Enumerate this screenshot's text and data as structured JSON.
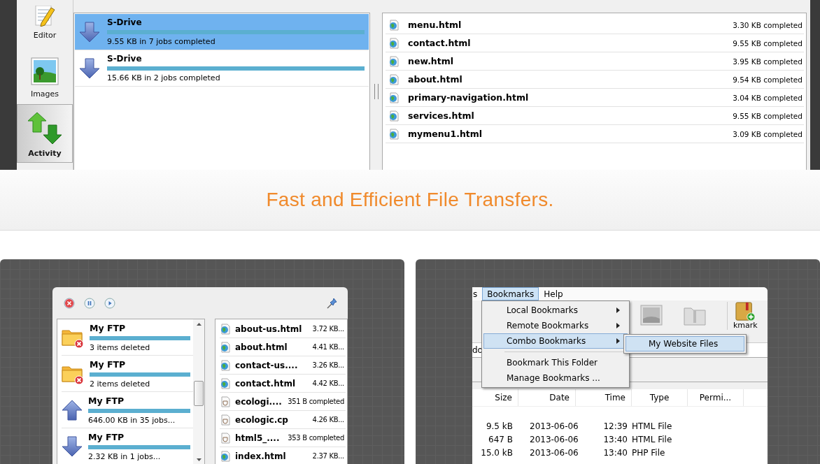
{
  "top_app": {
    "sidebar": {
      "items": [
        {
          "label": "Editor",
          "kind": "editor",
          "selected": false
        },
        {
          "label": "Images",
          "kind": "images",
          "selected": false
        },
        {
          "label": "Activity",
          "kind": "activity",
          "selected": true
        }
      ]
    },
    "transfers": [
      {
        "name": "S-Drive",
        "kind": "download",
        "level": 1,
        "status": "9.55 KB in 7 jobs completed",
        "selected": true
      },
      {
        "name": "S-Drive",
        "kind": "download",
        "level": 1,
        "status": "15.66 KB in 2 jobs completed",
        "selected": false
      }
    ],
    "files": [
      {
        "name": "menu.html",
        "status": "3.30 KB completed"
      },
      {
        "name": "contact.html",
        "status": "9.55 KB completed"
      },
      {
        "name": "new.html",
        "status": "3.95 KB completed"
      },
      {
        "name": "about.html",
        "status": "9.54 KB completed"
      },
      {
        "name": "primary-navigation.html",
        "status": "3.04 KB completed"
      },
      {
        "name": "services.html",
        "status": "9.55 KB completed"
      },
      {
        "name": "mymenu1.html",
        "status": "3.09 KB completed"
      }
    ]
  },
  "banner": {
    "title": "Fast and Efficient File Transfers."
  },
  "activity_window": {
    "transfers": [
      {
        "name": "My FTP",
        "kind": "deleted",
        "level": 1,
        "status": "3 items deleted"
      },
      {
        "name": "My FTP",
        "kind": "deleted",
        "level": 1,
        "status": "2 items deleted"
      },
      {
        "name": "My FTP",
        "kind": "upload",
        "level": 1,
        "status": "646.00 KB in 35 jobs..."
      },
      {
        "name": "My FTP",
        "kind": "download",
        "level": 1,
        "status": "2.32 KB in 1 jobs..."
      }
    ],
    "files": [
      {
        "name": "about-us.html",
        "kind": "web",
        "status": "3.72 KB..."
      },
      {
        "name": "about.html",
        "kind": "web",
        "status": "4.41 KB..."
      },
      {
        "name": "contact-us....",
        "kind": "web",
        "status": "3.26 KB..."
      },
      {
        "name": "contact.html",
        "kind": "web",
        "status": "4.42 KB..."
      },
      {
        "name": "ecologi....",
        "kind": "script",
        "status": "351 B completed"
      },
      {
        "name": "ecologic.cp",
        "kind": "script",
        "status": "4.26 KB..."
      },
      {
        "name": "html5_....",
        "kind": "script",
        "status": "353 B completed"
      },
      {
        "name": "index.html",
        "kind": "web",
        "status": "2.37 KB..."
      }
    ]
  },
  "browser_window": {
    "menubar": [
      {
        "label": "s",
        "selected": false
      },
      {
        "label": "Bookmarks",
        "selected": true
      },
      {
        "label": "Help",
        "selected": false
      }
    ],
    "toolbar_label": "kmark",
    "address": "do",
    "menu": {
      "groups": [
        [
          {
            "label": "Local Bookmarks",
            "submenu": true,
            "selected": false
          },
          {
            "label": "Remote Bookmarks",
            "submenu": true,
            "selected": false
          },
          {
            "label": "Combo Bookmarks",
            "submenu": true,
            "selected": true
          }
        ],
        [
          {
            "label": "Bookmark This Folder",
            "submenu": false,
            "selected": false
          },
          {
            "label": "Manage Bookmarks ...",
            "submenu": false,
            "selected": false
          }
        ]
      ],
      "submenu": [
        {
          "label": "My Website Files",
          "selected": true
        }
      ]
    },
    "table": {
      "columns": [
        "Size",
        "Date",
        "Time",
        "Type",
        "Permi..."
      ],
      "rows": [
        [
          "9.5 kB",
          "2013-06-06",
          "12:39",
          "HTML File"
        ],
        [
          "647 B",
          "2013-06-06",
          "13:40",
          "HTML File"
        ],
        [
          "15.0 kB",
          "2013-06-06",
          "13:40",
          "PHP File"
        ]
      ]
    }
  }
}
